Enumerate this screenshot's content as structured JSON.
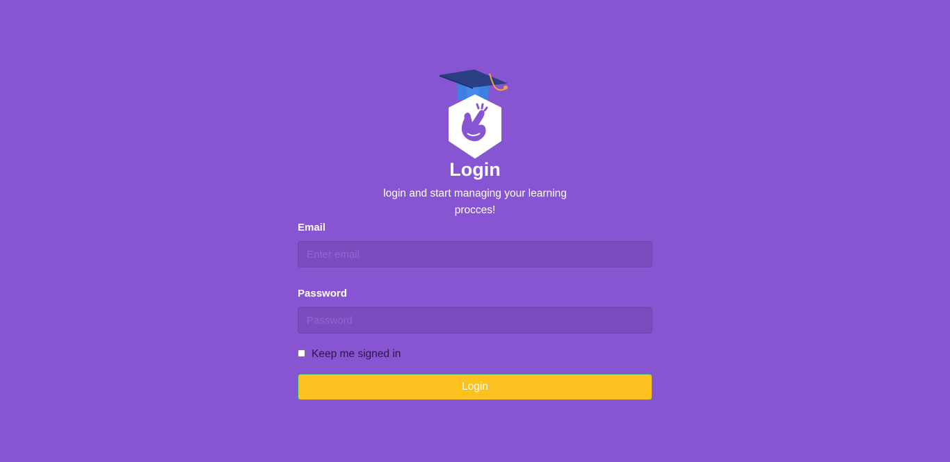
{
  "header": {
    "logo_icon": "graduation-cap-crossed-fingers-logo",
    "title": "Login",
    "subtitle": "login and start managing your learning procces!"
  },
  "form": {
    "email_label": "Email",
    "email_placeholder": "Enter email",
    "email_value": "",
    "password_label": "Password",
    "password_placeholder": "Password",
    "password_value": "",
    "remember_label": "Keep me signed in",
    "remember_checked": false,
    "submit_label": "Login"
  },
  "colors": {
    "background": "#8755d2",
    "button": "#fbc11f",
    "input_background": "#7a4cbe"
  }
}
